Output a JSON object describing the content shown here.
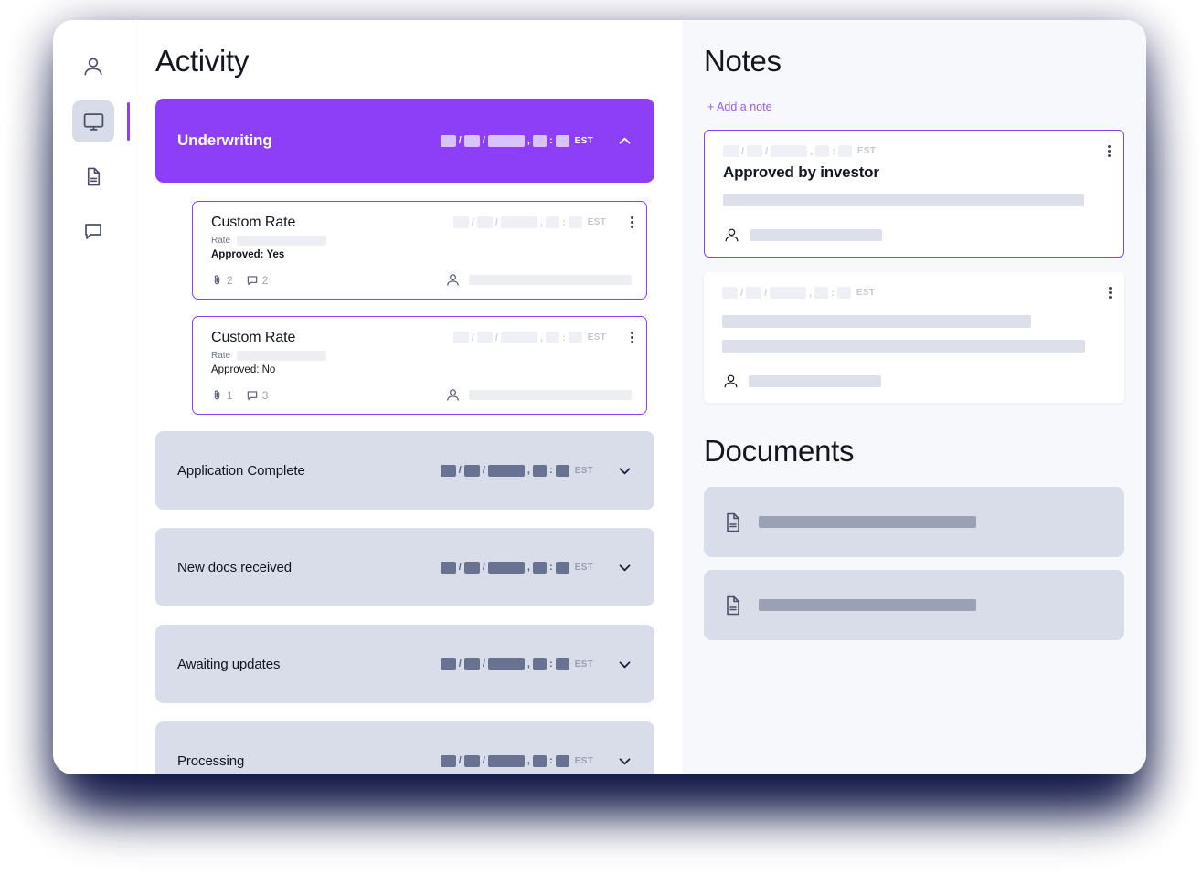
{
  "sidebar": {
    "items": [
      {
        "name": "profile",
        "icon": "user-icon",
        "active": false
      },
      {
        "name": "dashboard",
        "icon": "monitor-icon",
        "active": true
      },
      {
        "name": "documents",
        "icon": "document-icon",
        "active": false
      },
      {
        "name": "messages",
        "icon": "chat-bubble-icon",
        "active": false
      }
    ]
  },
  "activity": {
    "title": "Activity",
    "underwriting": {
      "label": "Underwriting",
      "timestamp": {
        "est": "EST",
        "slash": "/",
        "comma": ",",
        "colon": ":"
      },
      "expanded": true
    },
    "rate_cards": [
      {
        "title": "Custom Rate",
        "rate_label": "Rate",
        "approved_label": "Approved: Yes",
        "approved": "Yes",
        "attachments": "2",
        "comments": "2"
      },
      {
        "title": "Custom Rate",
        "rate_label": "Rate",
        "approved_label": "Approved: No",
        "approved": "No",
        "attachments": "1",
        "comments": "3"
      }
    ],
    "stages": [
      {
        "label": "Application Complete"
      },
      {
        "label": "New docs received"
      },
      {
        "label": "Awaiting updates"
      },
      {
        "label": "Processing"
      }
    ]
  },
  "notes": {
    "title": "Notes",
    "add_label": "+ Add a note",
    "items": [
      {
        "title": "Approved by investor",
        "body_lines": 1,
        "selected": true
      },
      {
        "title": "",
        "body_lines": 2,
        "selected": false
      }
    ]
  },
  "documents": {
    "title": "Documents",
    "items": [
      {
        "name": ""
      },
      {
        "name": ""
      }
    ]
  },
  "timestamp_parts": {
    "slash": "/",
    "comma": ",",
    "colon": ":",
    "est": "EST"
  },
  "colors": {
    "accent_purple": "#8c3ff7",
    "link_purple": "#9b59f5",
    "stage_bg": "#d9dde9",
    "panel_bg": "#f7f8fc",
    "text_dark": "#13161f"
  }
}
